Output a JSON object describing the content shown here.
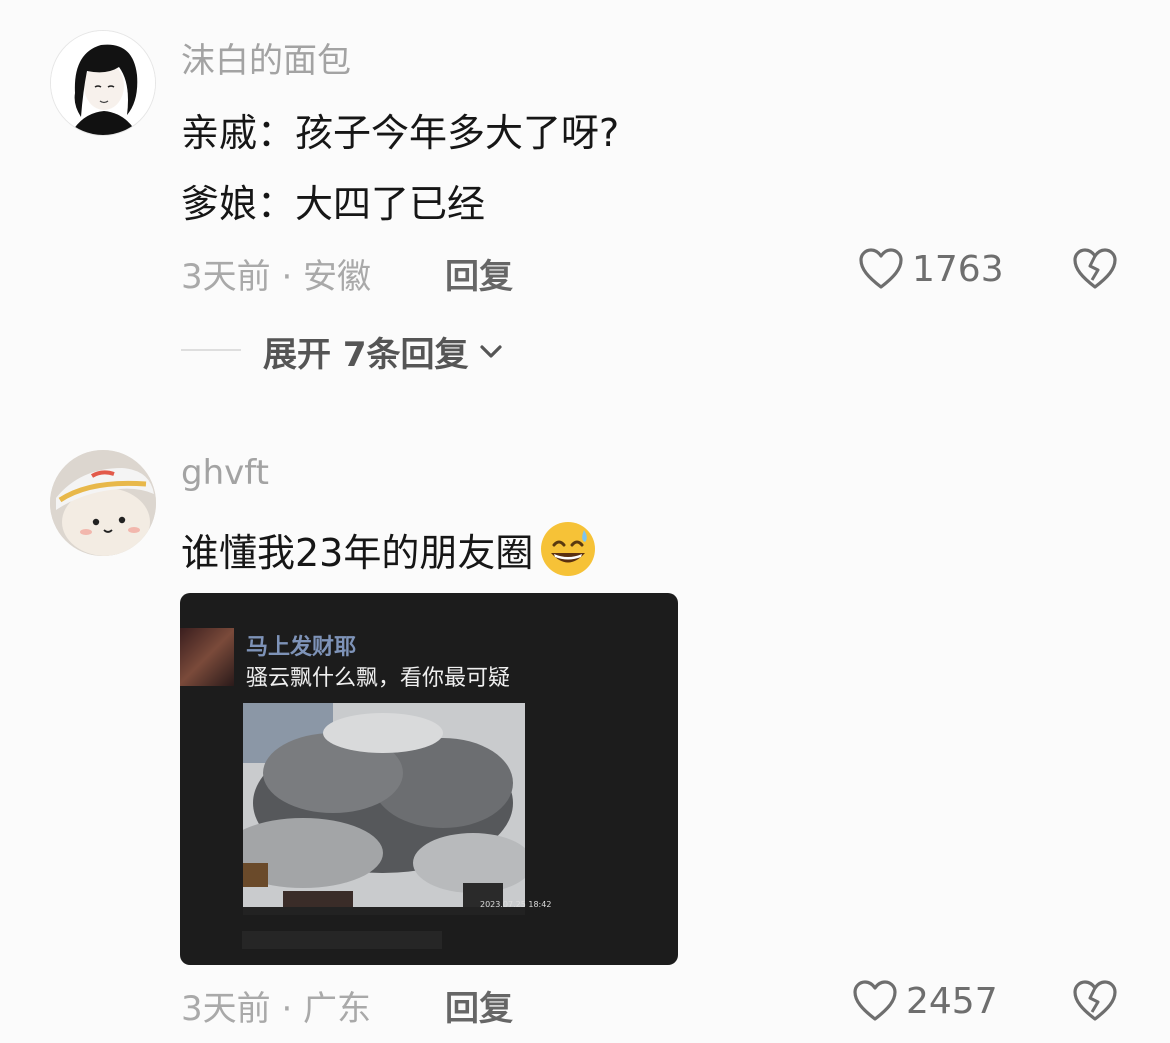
{
  "comments": [
    {
      "username": "沫白的面包",
      "lines": [
        "亲戚：孩子今年多大了呀?",
        "爹娘：大四了已经"
      ],
      "meta": "3天前 · 安徽",
      "reply_label": "回复",
      "likes": "1763",
      "expand_label": "展开 7条回复"
    },
    {
      "username": "ghvft",
      "lines": [
        "谁懂我23年的朋友圈"
      ],
      "emoji": "😅",
      "meta": "3天前 · 广东",
      "reply_label": "回复",
      "likes": "2457",
      "attachment": {
        "name": "马上发财耶",
        "text": "骚云飘什么飘，看你最可疑",
        "stamp": "2023.07.25 18:42"
      }
    }
  ],
  "icons": {
    "like": "heart-outline-icon",
    "dislike": "broken-heart-icon",
    "expand": "chevron-down-icon"
  },
  "colors": {
    "background": "#fbfbfb",
    "text": "#161616",
    "muted": "#a9a9a9",
    "screenshot_bg": "#1c1c1c",
    "screenshot_name": "#7e93b8"
  }
}
